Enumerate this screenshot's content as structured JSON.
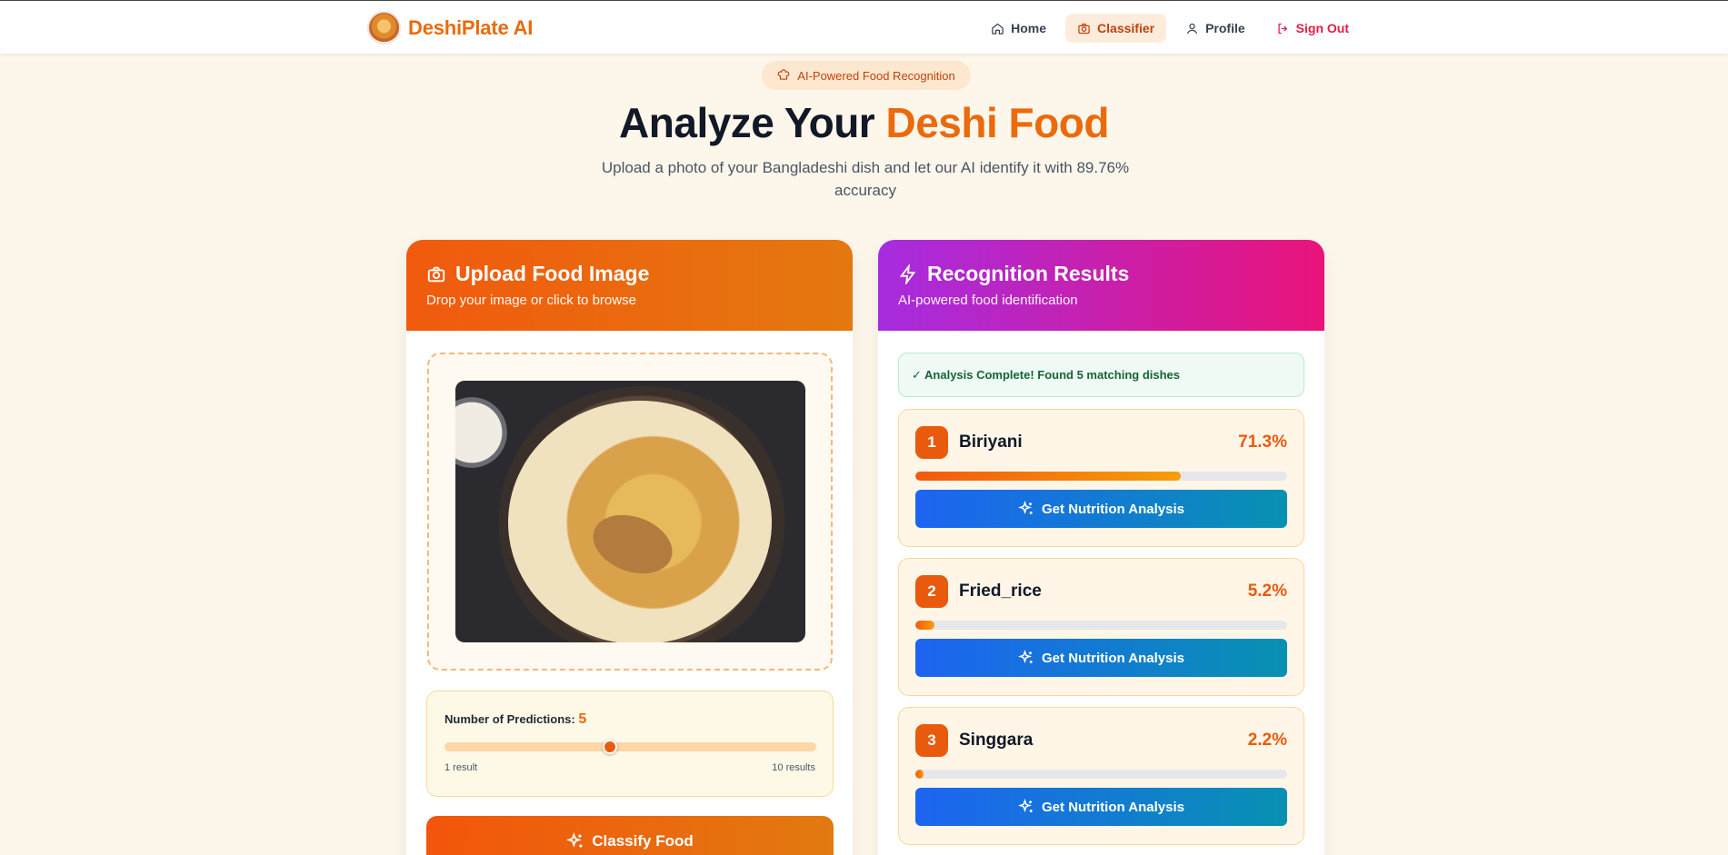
{
  "brand": {
    "name": "DeshiPlate AI"
  },
  "nav": {
    "items": [
      {
        "label": "Home",
        "icon": "home-icon"
      },
      {
        "label": "Classifier",
        "icon": "camera-icon"
      },
      {
        "label": "Profile",
        "icon": "user-icon"
      },
      {
        "label": "Sign Out",
        "icon": "sign-out-icon"
      }
    ]
  },
  "hero": {
    "badge": "AI-Powered Food Recognition",
    "title_prefix": "Analyze Your ",
    "title_accent": "Deshi Food",
    "subtitle": "Upload a photo of your Bangladeshi dish and let our AI identify it with 89.76% accuracy"
  },
  "upload": {
    "title": "Upload Food Image",
    "subtitle": "Drop your image or click to browse",
    "slider_label": "Number of Predictions:",
    "slider_value": "5",
    "slider_min_label": "1 result",
    "slider_max_label": "10 results",
    "slider_fraction": 0.444,
    "classify_label": "Classify Food"
  },
  "results": {
    "title": "Recognition Results",
    "subtitle": "AI-powered food identification",
    "status": "✓ Analysis Complete! Found 5 matching dishes",
    "button_label": "Get Nutrition Analysis",
    "items": [
      {
        "rank": "1",
        "name": "Biriyani",
        "confidence": "71.3%",
        "fraction": 0.713
      },
      {
        "rank": "2",
        "name": "Fried_rice",
        "confidence": "5.2%",
        "fraction": 0.052
      },
      {
        "rank": "3",
        "name": "Singgara",
        "confidence": "2.2%",
        "fraction": 0.022
      }
    ]
  },
  "colors": {
    "brand_orange": "#ea6a0c",
    "results_gradient_start": "#a62ce0",
    "results_gradient_end": "#e9147a",
    "nutrition_button": "#1d64f2"
  }
}
